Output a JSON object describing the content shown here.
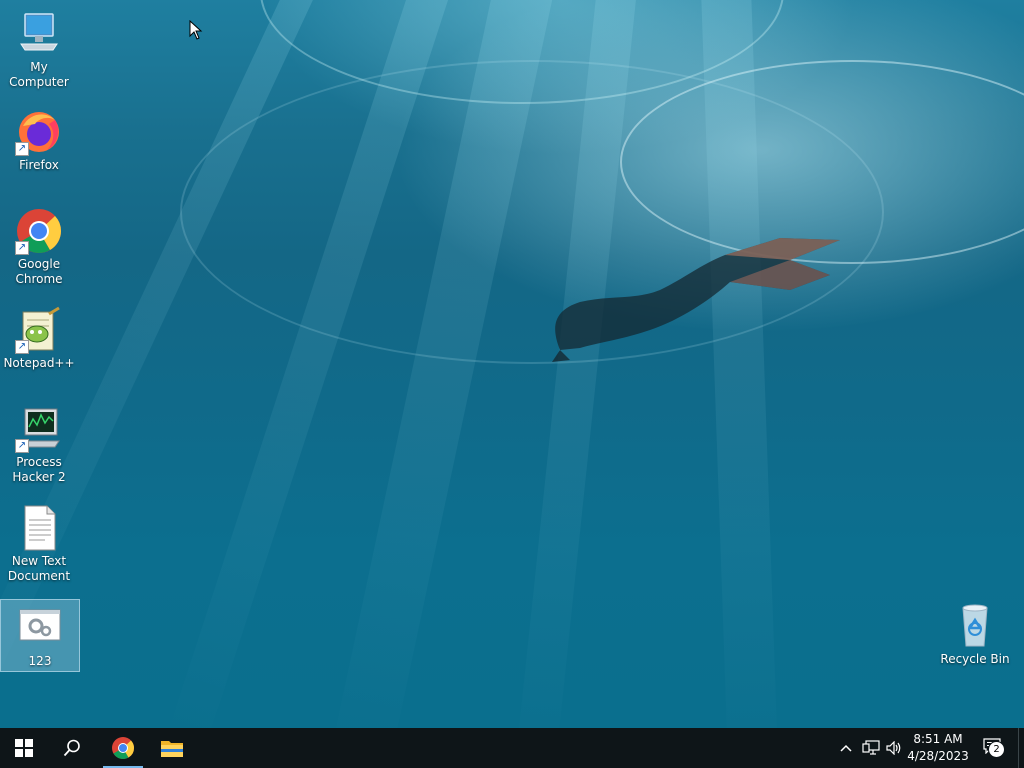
{
  "desktop": {
    "icons": [
      {
        "label": "My Computer",
        "icon": "computer-icon"
      },
      {
        "label": "Firefox",
        "icon": "firefox-icon"
      },
      {
        "label": "Google Chrome",
        "icon": "chrome-icon"
      },
      {
        "label": "Notepad++",
        "icon": "notepadpp-icon"
      },
      {
        "label": "Process Hacker 2",
        "icon": "process-hacker-icon"
      },
      {
        "label": "New Text Document",
        "icon": "text-document-icon"
      },
      {
        "label": "123",
        "icon": "application-icon"
      }
    ],
    "recycle_bin": {
      "label": "Recycle Bin",
      "icon": "recycle-bin-icon"
    }
  },
  "taskbar": {
    "start": "start-icon",
    "search": "search-icon",
    "pinned": [
      {
        "name": "Google Chrome",
        "icon": "chrome-icon",
        "active": true
      },
      {
        "name": "File Explorer",
        "icon": "folder-icon",
        "active": false
      }
    ],
    "tray": {
      "show_hidden": "chevron-up-icon",
      "network": "network-icon",
      "volume": "speaker-icon",
      "time": "8:51 AM",
      "date": "4/28/2023",
      "notifications_count": "2"
    }
  },
  "colors": {
    "taskbar_bg": "#0e1518",
    "accent": "#76b9ed",
    "water": "#106a8a"
  }
}
